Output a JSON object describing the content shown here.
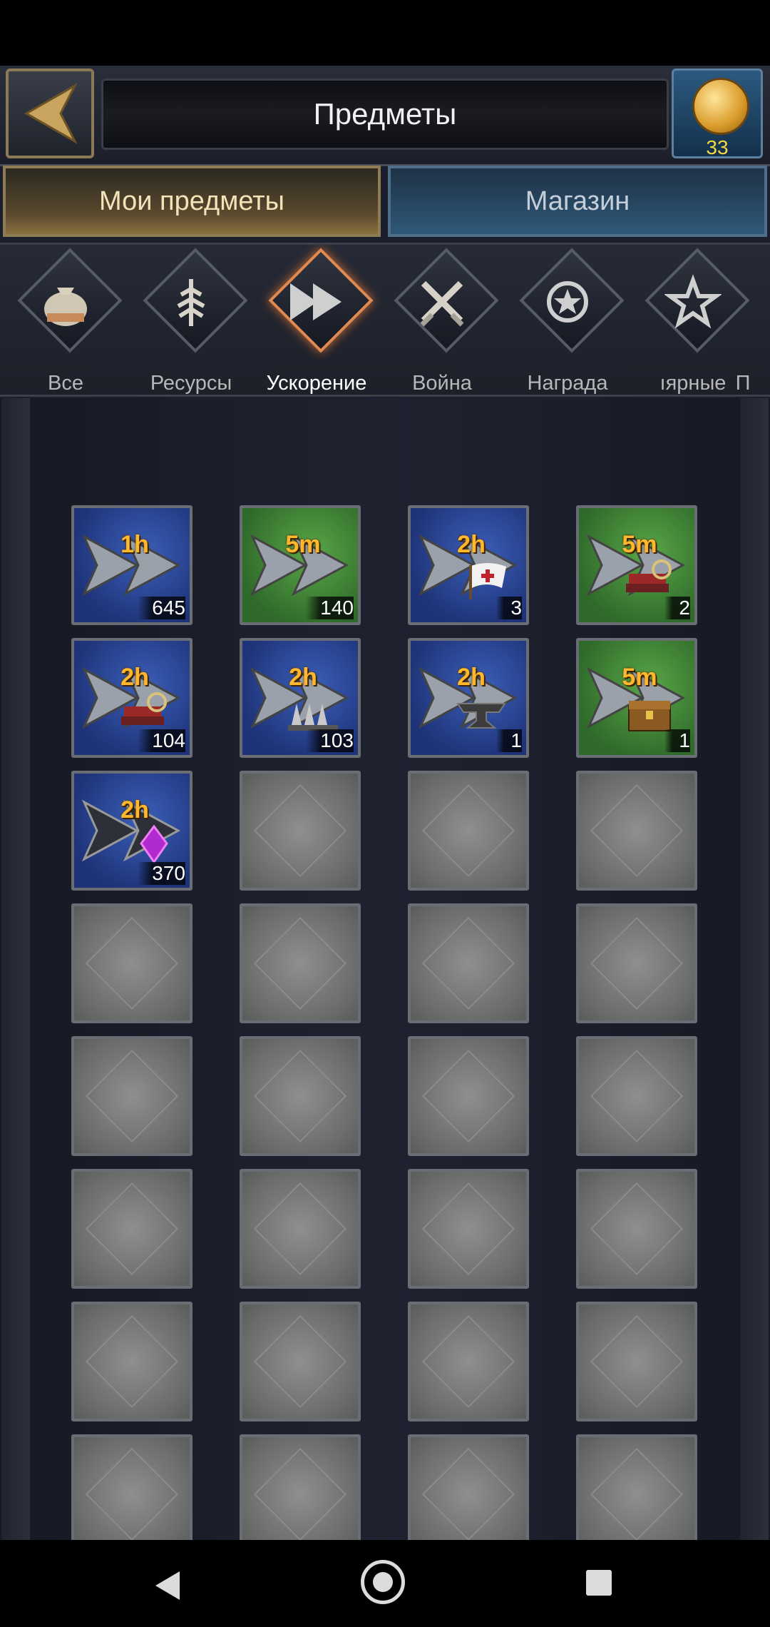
{
  "header": {
    "title": "Предметы",
    "coin_count": "33"
  },
  "tabs": [
    {
      "label": "Мои предметы",
      "active": true
    },
    {
      "label": "Магазин",
      "active": false
    }
  ],
  "categories": [
    {
      "label": "Все",
      "icon": "bag-icon"
    },
    {
      "label": "Ресурсы",
      "icon": "leaf-icon"
    },
    {
      "label": "Ускорение",
      "icon": "fast-forward-icon",
      "active": true
    },
    {
      "label": "Война",
      "icon": "crossed-swords-icon"
    },
    {
      "label": "Награда",
      "icon": "star-medal-icon"
    },
    {
      "label": "ıярные",
      "icon": "star-icon"
    },
    {
      "label": "П",
      "icon": ""
    }
  ],
  "items": [
    {
      "time": "1h",
      "count": "645",
      "color": "blue",
      "icon": "speedup-icon"
    },
    {
      "time": "5m",
      "count": "140",
      "color": "green",
      "icon": "speedup-icon"
    },
    {
      "time": "2h",
      "count": "3",
      "color": "blue",
      "icon": "healing-flag-icon"
    },
    {
      "time": "5m",
      "count": "2",
      "color": "green",
      "icon": "research-books-icon"
    },
    {
      "time": "2h",
      "count": "104",
      "color": "blue",
      "icon": "research-books-icon"
    },
    {
      "time": "2h",
      "count": "103",
      "color": "blue",
      "icon": "spikes-icon"
    },
    {
      "time": "2h",
      "count": "1",
      "color": "blue",
      "icon": "anvil-icon"
    },
    {
      "time": "5m",
      "count": "1",
      "color": "green",
      "icon": "chest-icon"
    },
    {
      "time": "2h",
      "count": "370",
      "color": "blue",
      "icon": "magic-crystal-icon"
    }
  ],
  "colors": {
    "accent": "#e08a52",
    "time_label": "#ffb82e",
    "coin_count": "#f5d742"
  }
}
